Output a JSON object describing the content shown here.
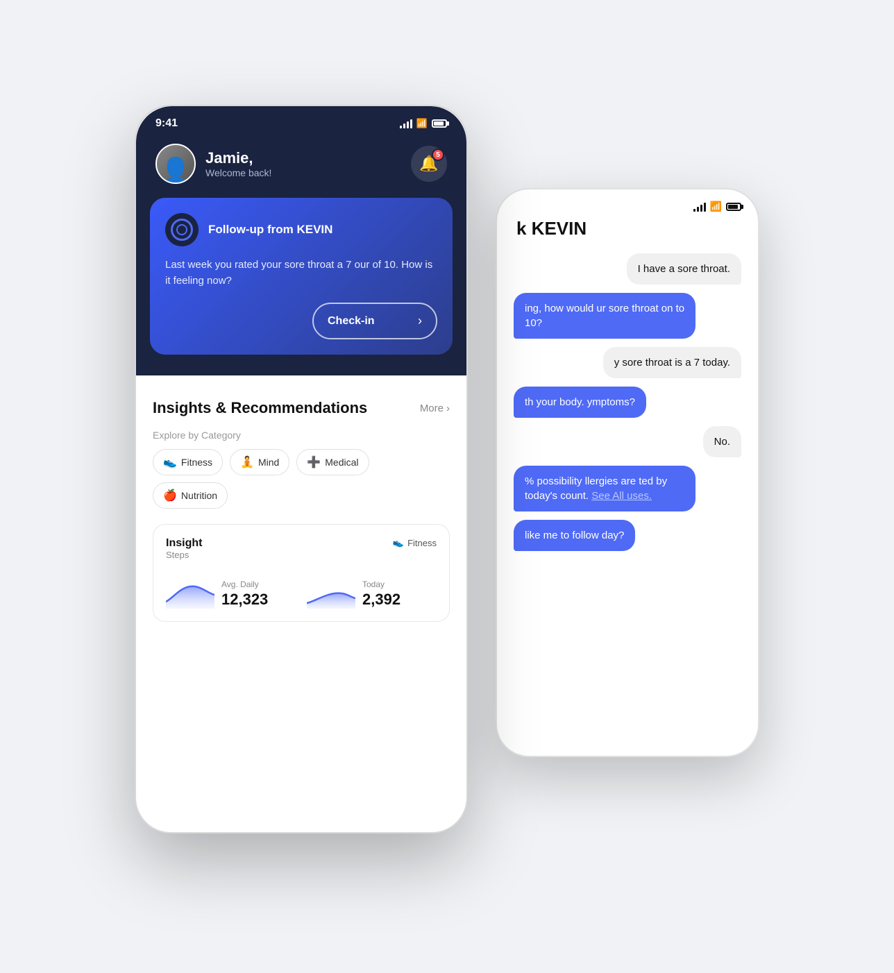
{
  "scene": {
    "bg_color": "#eef0f5"
  },
  "phone_front": {
    "status": {
      "time": "9:41",
      "signal_bars": 4,
      "battery_full": true
    },
    "profile": {
      "name": "Jamie,",
      "subtitle": "Welcome back!",
      "notification_count": "5"
    },
    "kevin_card": {
      "title": "Follow-up from KEVIN",
      "message": "Last week you rated your sore throat a 7 our of 10. How is it feeling now?",
      "checkin_label": "Check-in",
      "checkin_arrow": "›"
    },
    "insights": {
      "title": "Insights & Recommendations",
      "more_label": "More",
      "explore_label": "Explore by Category",
      "categories": [
        {
          "emoji": "👟",
          "label": "Fitness"
        },
        {
          "emoji": "🧘",
          "label": "Mind"
        },
        {
          "emoji": "➕",
          "label": "Medical"
        },
        {
          "emoji": "🍎",
          "label": "Nutrition"
        }
      ],
      "insight_card": {
        "label": "Insight",
        "sub": "Steps",
        "category_emoji": "👟",
        "category_label": "Fitness",
        "avg_label": "Avg. Daily",
        "avg_value": "12,323",
        "today_label": "Today",
        "today_value": "2,392"
      }
    }
  },
  "phone_back": {
    "status": {
      "signal_bars": 4,
      "battery_full": true
    },
    "chat_header": "k KEVIN",
    "messages": [
      {
        "type": "user",
        "text": "I have a sore throat."
      },
      {
        "type": "ai",
        "text": "ing, how would ur sore throat on to 10?"
      },
      {
        "type": "user",
        "text": "y sore throat is a 7 today."
      },
      {
        "type": "ai",
        "text": "th your body. ymptoms?"
      },
      {
        "type": "user",
        "text": "No."
      },
      {
        "type": "ai",
        "text": "% possibility llergies are ted by today's count. See All uses."
      },
      {
        "type": "ai",
        "text": "like me to follow day?"
      }
    ]
  }
}
